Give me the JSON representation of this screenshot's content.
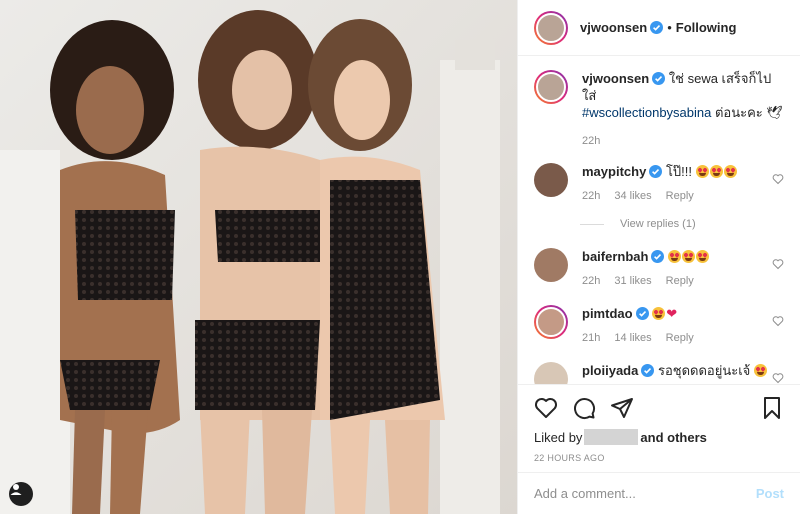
{
  "header": {
    "username": "vjwoonsen",
    "separator": "•",
    "follow_status": "Following"
  },
  "caption": {
    "username": "vjwoonsen",
    "text": "ใช่ sewa เสร็จก็ไปใส่",
    "hashtag": "#wscollectionbysabina",
    "text_after": "ต่อนะคะ 🕊",
    "time": "22h"
  },
  "comments": [
    {
      "username": "maypitchy",
      "text": "โป๊!!!",
      "emoji_count": 3,
      "time": "22h",
      "likes": "34 likes",
      "reply": "Reply"
    },
    {
      "username": "baifernbah",
      "text": "",
      "emoji_count": 3,
      "time": "22h",
      "likes": "31 likes",
      "reply": "Reply"
    },
    {
      "username": "pimtdao",
      "text": "",
      "emoji_count": 1,
      "heart": "❤",
      "time": "21h",
      "likes": "14 likes",
      "reply": "Reply"
    },
    {
      "username": "ploiiyada",
      "text": "รอชุดดดอยู่นะเจ้",
      "emoji_count": 1
    }
  ],
  "view_replies": "View replies (1)",
  "likes": {
    "prefix": "Liked by",
    "suffix": "and others"
  },
  "post_time": "22 HOURS AGO",
  "add_comment": {
    "placeholder": "Add a comment...",
    "post_label": "Post"
  },
  "colors": {
    "link": "#00376b",
    "muted": "#8e8e8e",
    "verified": "#3897f0",
    "post_disabled": "#b2dffc"
  }
}
